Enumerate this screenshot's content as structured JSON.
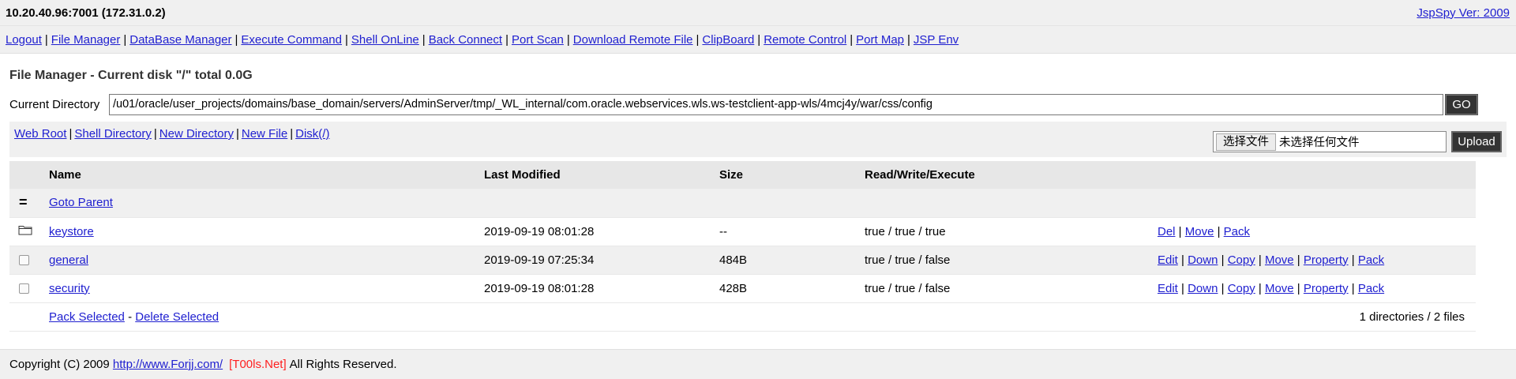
{
  "header": {
    "host": "10.20.40.96:7001 (172.31.0.2)",
    "version_link": "JspSpy Ver: 2009"
  },
  "nav": [
    "Logout",
    "File Manager",
    "DataBase Manager",
    "Execute Command",
    "Shell OnLine",
    "Back Connect",
    "Port Scan",
    "Download Remote File",
    "ClipBoard",
    "Remote Control",
    "Port Map",
    "JSP Env"
  ],
  "page": {
    "title": "File Manager - Current disk \"/\" total 0.0G",
    "current_dir_label": "Current Directory",
    "current_dir_value": "/u01/oracle/user_projects/domains/base_domain/servers/AdminServer/tmp/_WL_internal/com.oracle.webservices.wls.ws-testclient-app-wls/4mcj4y/war/css/config",
    "go_label": "GO"
  },
  "toolbar": {
    "links": [
      "Web Root",
      "Shell Directory",
      "New Directory",
      "New File",
      "Disk(/)"
    ],
    "choose_file_label": "选择文件",
    "no_file_text": "未选择任何文件",
    "upload_label": "Upload"
  },
  "table": {
    "headers": [
      "Name",
      "Last Modified",
      "Size",
      "Read/Write/Execute"
    ],
    "parent_symbol": "=",
    "parent_label": "Goto Parent",
    "rows": [
      {
        "name": "keystore",
        "modified": "2019-09-19 08:01:28",
        "size": "--",
        "perms": "true / true / true",
        "type": "folder-icon",
        "actions": [
          "Del",
          "Move",
          "Pack"
        ]
      },
      {
        "name": "general",
        "modified": "2019-09-19 07:25:34",
        "size": "484B",
        "perms": "true / true / false",
        "type": "file",
        "actions": [
          "Edit",
          "Down",
          "Copy",
          "Move",
          "Property",
          "Pack"
        ]
      },
      {
        "name": "security",
        "modified": "2019-09-19 08:01:28",
        "size": "428B",
        "perms": "true / true / false",
        "type": "file",
        "actions": [
          "Edit",
          "Down",
          "Copy",
          "Move",
          "Property",
          "Pack"
        ]
      }
    ],
    "pack_selected": "Pack Selected",
    "dash": "-",
    "delete_selected": "Delete Selected",
    "count_text": "1 directories / 2 files"
  },
  "footer": {
    "copyright": "Copyright (C) 2009",
    "site_link": "http://www.Forjj.com/",
    "tools": "[T00ls.Net]",
    "rights": "All Rights Reserved."
  },
  "colors": {
    "link": "#2020d0",
    "tools_red": "#ff2020",
    "button_dark": "#333333"
  }
}
